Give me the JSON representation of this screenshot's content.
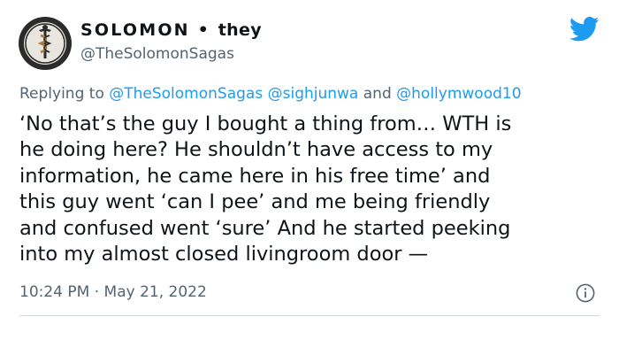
{
  "user": {
    "display_name": "SOLOMON",
    "separator": "•",
    "pronouns": "they",
    "handle": "@TheSolomonSagas",
    "avatar_icon": "caduceus-badge-icon"
  },
  "brand": {
    "icon": "twitter-bird-icon",
    "color": "#1d9bf0"
  },
  "reply": {
    "prefix": "Replying to",
    "mention_1": "@TheSolomonSagas",
    "mention_2": "@sighjunwa",
    "joiner": "and",
    "mention_3": "@hollymwood10"
  },
  "tweet": {
    "lines": [
      "‘No that’s the guy I bought a thing from… WTH is",
      "he doing here? He shouldn’t have access to my",
      "information, he came here in his free time’ and",
      "this guy went ‘can I pee’ and me being friendly",
      "and confused went ‘sure’ And he started peeking",
      "into my almost closed livingroom door —"
    ]
  },
  "meta": {
    "time": "10:24 PM",
    "dot": "·",
    "date": "May 21, 2022",
    "info_icon": "info-icon"
  },
  "colors": {
    "text": "#0f1419",
    "secondary": "#536471",
    "link": "#1d9bf0",
    "divider": "#cfd9de"
  }
}
